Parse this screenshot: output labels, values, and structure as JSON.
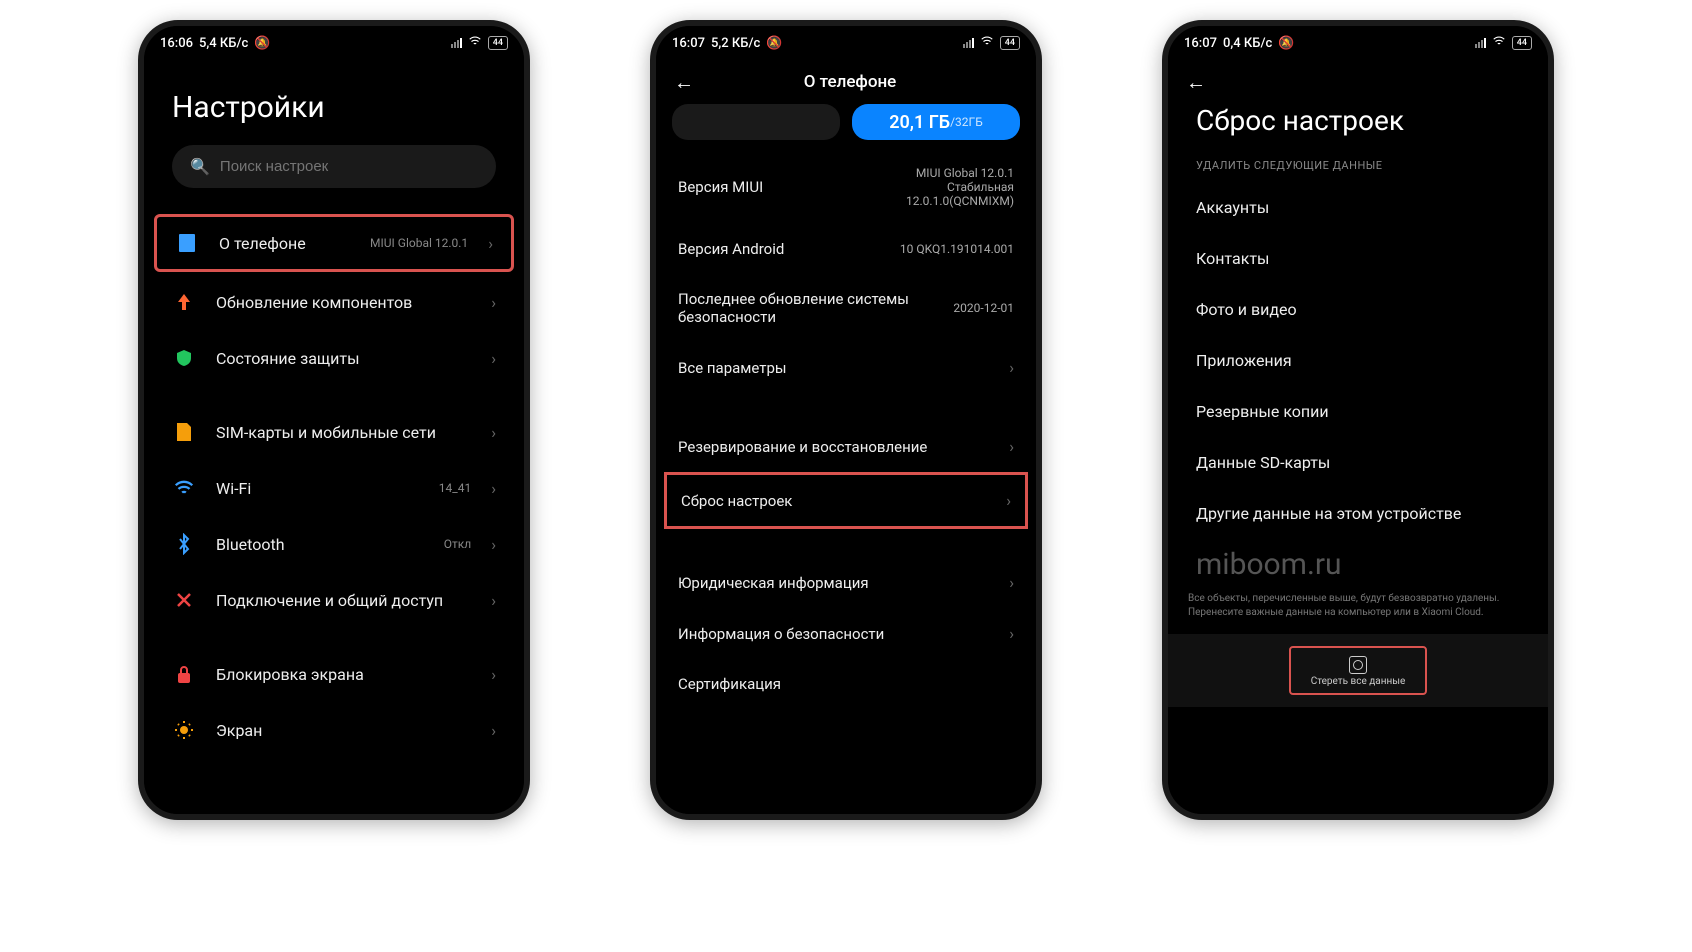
{
  "phone1": {
    "status": {
      "time": "16:06",
      "speed": "5,4 КБ/с",
      "battery": "44"
    },
    "title": "Настройки",
    "search_placeholder": "Поиск настроек",
    "items": [
      {
        "label": "О телефоне",
        "value": "MIUI Global 12.0.1",
        "highlighted": true
      },
      {
        "label": "Обновление компонентов",
        "value": ""
      },
      {
        "label": "Состояние защиты",
        "value": ""
      }
    ],
    "items2": [
      {
        "label": "SIM-карты и мобильные сети",
        "value": ""
      },
      {
        "label": "Wi-Fi",
        "value": "14_41"
      },
      {
        "label": "Bluetooth",
        "value": "Откл"
      },
      {
        "label": "Подключение и общий доступ",
        "value": ""
      }
    ],
    "items3": [
      {
        "label": "Блокировка экрана",
        "value": ""
      },
      {
        "label": "Экран",
        "value": ""
      }
    ]
  },
  "phone2": {
    "status": {
      "time": "16:07",
      "speed": "5,2 КБ/с",
      "battery": "44"
    },
    "header": "О телефоне",
    "storage_main": "20,1 ГБ",
    "storage_total": "/32ГБ",
    "rows": [
      {
        "label": "Версия MIUI",
        "value": "MIUI Global 12.0.1\nСтабильная\n12.0.1.0(QCNMIXM)"
      },
      {
        "label": "Версия Android",
        "value": "10 QKQ1.191014.001"
      },
      {
        "label": "Последнее обновление системы безопасности",
        "value": "2020-12-01"
      },
      {
        "label": "Все параметры",
        "value": "",
        "chevron": true
      }
    ],
    "rows2": [
      {
        "label": "Резервирование и восстановление",
        "chevron": true
      },
      {
        "label": "Сброс настроек",
        "chevron": true,
        "highlighted": true
      }
    ],
    "rows3": [
      {
        "label": "Юридическая информация",
        "chevron": true
      },
      {
        "label": "Информация о безопасности",
        "chevron": true
      },
      {
        "label": "Сертификация"
      }
    ]
  },
  "phone3": {
    "status": {
      "time": "16:07",
      "speed": "0,4 КБ/с",
      "battery": "44"
    },
    "title": "Сброс настроек",
    "section_label": "УДАЛИТЬ СЛЕДУЮЩИЕ ДАННЫЕ",
    "items": [
      "Аккаунты",
      "Контакты",
      "Фото и видео",
      "Приложения",
      "Резервные копии",
      "Данные SD-карты",
      "Другие данные на этом устройстве"
    ],
    "watermark": "miboom.ru",
    "footer_note": "Все объекты, перечисленные выше, будут безвозвратно удалены. Перенесите важные данные на компьютер или в Xiaomi Cloud.",
    "erase_label": "Стереть все данные"
  }
}
